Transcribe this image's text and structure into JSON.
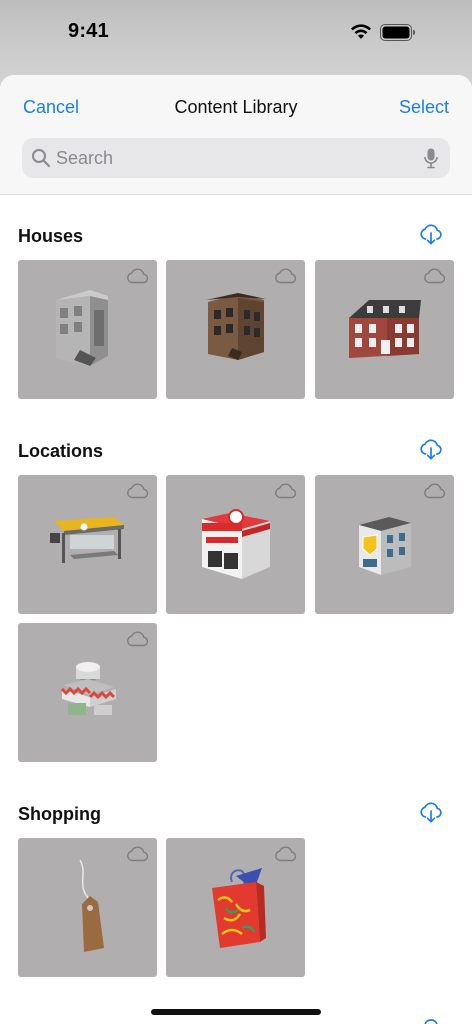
{
  "status": {
    "time": "9:41"
  },
  "nav": {
    "cancel_label": "Cancel",
    "title": "Content Library",
    "select_label": "Select"
  },
  "search": {
    "placeholder": "Search",
    "value": ""
  },
  "sections": [
    {
      "title": "Houses",
      "items": [
        {
          "icon": "townhouse-3d"
        },
        {
          "icon": "brownstone-3d"
        },
        {
          "icon": "brick-manor-3d"
        }
      ]
    },
    {
      "title": "Locations",
      "items": [
        {
          "icon": "bus-stop-3d"
        },
        {
          "icon": "fire-station-3d"
        },
        {
          "icon": "police-station-3d"
        },
        {
          "icon": "cafe-3d"
        }
      ]
    },
    {
      "title": "Shopping",
      "items": [
        {
          "icon": "price-tag-3d"
        },
        {
          "icon": "gift-bag-3d"
        }
      ]
    }
  ],
  "colors": {
    "accent": "#1b7cf2",
    "tile_bg": "#b1aeb0",
    "sheet_header": "#f7f7f8"
  }
}
